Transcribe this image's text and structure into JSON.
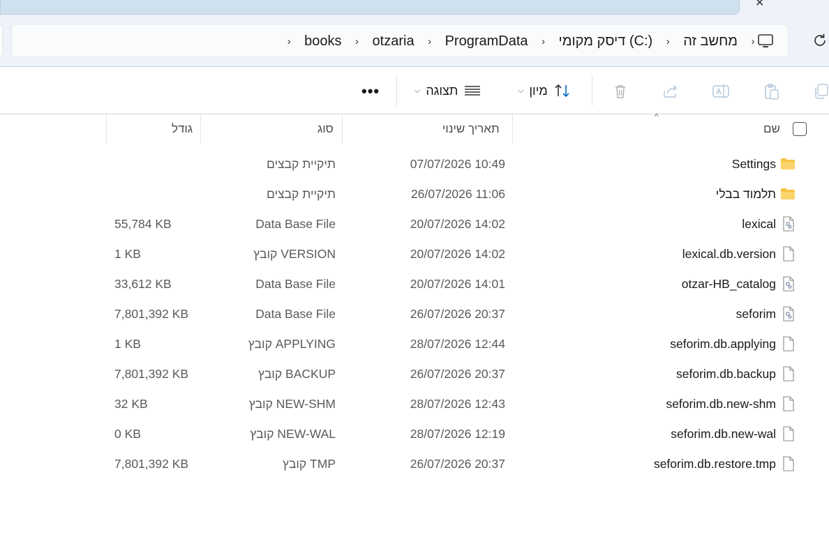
{
  "tab": {
    "close_glyph": "✕"
  },
  "address": {
    "crumbs": [
      "מחשב זה",
      "דיסק מקומי (C:)",
      "ProgramData",
      "otzaria",
      "books"
    ],
    "separator": "›"
  },
  "commands": {
    "sort_label": "מיון",
    "view_label": "תצוגה",
    "more_label": "•••"
  },
  "columns": {
    "name": "שם",
    "date": "תאריך שינוי",
    "type": "סוג",
    "size": "גודל"
  },
  "files": [
    {
      "name": "Settings",
      "date": "07/07/2026 10:49",
      "type": "תיקיית קבצים",
      "size": "",
      "icon": "folder-icon"
    },
    {
      "name": "תלמוד בבלי",
      "date": "26/07/2026 11:06",
      "type": "תיקיית קבצים",
      "size": "",
      "icon": "folder-icon"
    },
    {
      "name": "lexical",
      "date": "20/07/2026 14:02",
      "type": "Data Base File",
      "size": "55,784 KB",
      "icon": "database-file-icon"
    },
    {
      "name": "lexical.db.version",
      "date": "20/07/2026 14:02",
      "type": "קובץ VERSION",
      "size": "1 KB",
      "icon": "file-icon"
    },
    {
      "name": "otzar-HB_catalog",
      "date": "20/07/2026 14:01",
      "type": "Data Base File",
      "size": "33,612 KB",
      "icon": "database-file-icon"
    },
    {
      "name": "seforim",
      "date": "26/07/2026 20:37",
      "type": "Data Base File",
      "size": "7,801,392 KB",
      "icon": "database-file-icon"
    },
    {
      "name": "seforim.db.applying",
      "date": "28/07/2026 12:44",
      "type": "קובץ APPLYING",
      "size": "1 KB",
      "icon": "file-icon"
    },
    {
      "name": "seforim.db.backup",
      "date": "26/07/2026 20:37",
      "type": "קובץ BACKUP",
      "size": "7,801,392 KB",
      "icon": "file-icon"
    },
    {
      "name": "seforim.db.new-shm",
      "date": "28/07/2026 12:43",
      "type": "קובץ NEW-SHM",
      "size": "32 KB",
      "icon": "file-icon"
    },
    {
      "name": "seforim.db.new-wal",
      "date": "28/07/2026 12:19",
      "type": "קובץ NEW-WAL",
      "size": "0 KB",
      "icon": "file-icon"
    },
    {
      "name": "seforim.db.restore.tmp",
      "date": "26/07/2026 20:37",
      "type": "קובץ TMP",
      "size": "7,801,392 KB",
      "icon": "file-icon"
    }
  ],
  "colors": {
    "folder": "#f6c443",
    "accent": "#0067c0"
  }
}
